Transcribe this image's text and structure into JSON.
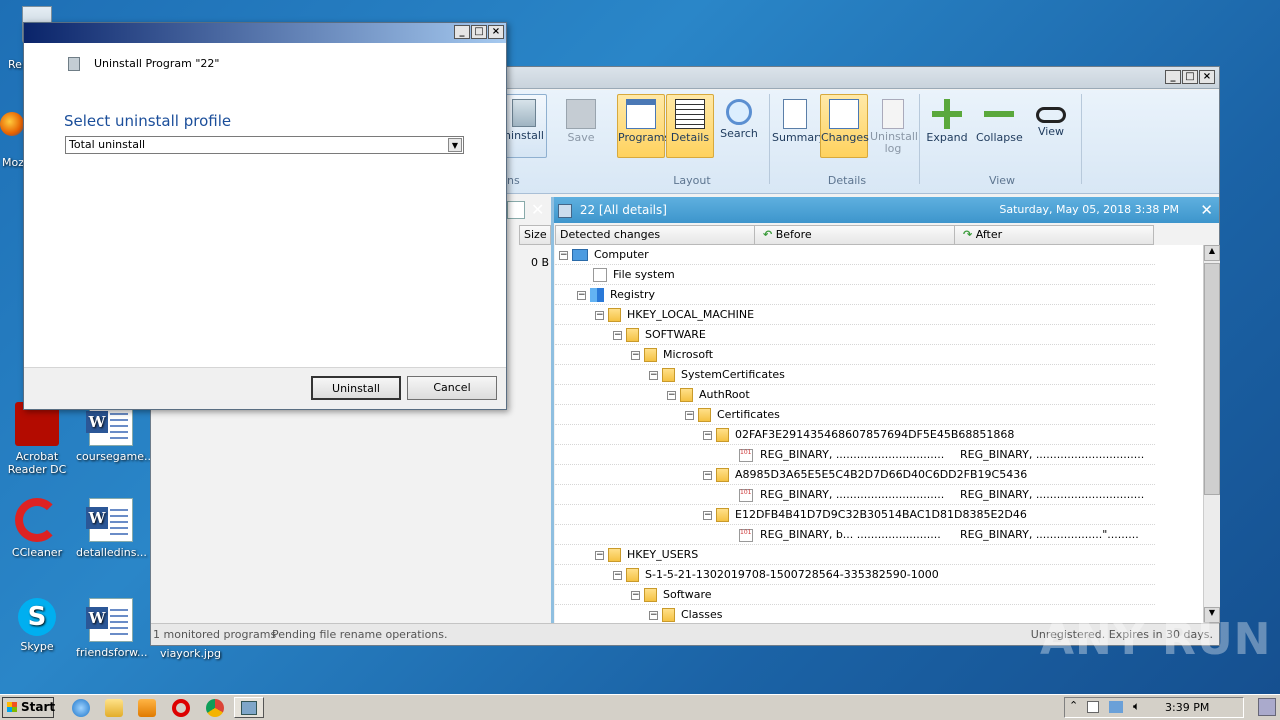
{
  "desktop": {
    "icons": [
      {
        "label": "Re",
        "kind": "recycle"
      },
      {
        "label": "Moz",
        "kind": "firefox"
      },
      {
        "label": "Acrobat Reader DC",
        "kind": "acrobat"
      },
      {
        "label": "coursegame...",
        "kind": "word"
      },
      {
        "label": "CCleaner",
        "kind": "ccleaner"
      },
      {
        "label": "detalledins...",
        "kind": "word"
      },
      {
        "label": "Skype",
        "kind": "skype"
      },
      {
        "label": "friendsforw...",
        "kind": "word"
      },
      {
        "label": "viayork.jpg",
        "kind": "image"
      }
    ],
    "watermark": "ANY RUN"
  },
  "main_window": {
    "ribbon": {
      "buttons": [
        {
          "label": "Uninstall",
          "visible_label": "ninstall",
          "state": "normal"
        },
        {
          "label": "Save",
          "state": "disabled"
        },
        {
          "label": "Programs",
          "state": "active"
        },
        {
          "label": "Details",
          "state": "active"
        },
        {
          "label": "Search",
          "state": "normal"
        },
        {
          "label": "Summary",
          "state": "normal"
        },
        {
          "label": "Changes",
          "state": "active"
        },
        {
          "label": "Uninstall log",
          "state": "disabled"
        },
        {
          "label": "Expand",
          "state": "normal"
        },
        {
          "label": "Collapse",
          "state": "normal"
        },
        {
          "label": "View",
          "state": "normal"
        }
      ],
      "groups": [
        "ns",
        "Layout",
        "Details",
        "View"
      ]
    },
    "left_panel": {
      "size_header": "Size",
      "size_value": "0 B"
    },
    "details_bar": {
      "title": "22 [All details]",
      "date": "Saturday, May 05, 2018 3:38 PM"
    },
    "columns": {
      "detected": "Detected changes",
      "before": "Before",
      "after": "After"
    },
    "tree": [
      {
        "text": "Computer",
        "before": "",
        "after": ""
      },
      {
        "text": "File system",
        "before": "",
        "after": ""
      },
      {
        "text": "Registry",
        "before": "",
        "after": ""
      },
      {
        "text": "HKEY_LOCAL_MACHINE",
        "before": "",
        "after": ""
      },
      {
        "text": "SOFTWARE",
        "before": "",
        "after": ""
      },
      {
        "text": "Microsoft",
        "before": "",
        "after": ""
      },
      {
        "text": "SystemCertificates",
        "before": "",
        "after": ""
      },
      {
        "text": "AuthRoot",
        "before": "",
        "after": ""
      },
      {
        "text": "Certificates",
        "before": "",
        "after": ""
      },
      {
        "text": "02FAF3E291435468607857694DF5E45B68851868",
        "before": "",
        "after": ""
      },
      {
        "text": "",
        "before": "REG_BINARY, ...............................",
        "after": "REG_BINARY, ..............................."
      },
      {
        "text": "A8985D3A65E5E5C4B2D7D66D40C6DD2FB19C5436",
        "before": "",
        "after": ""
      },
      {
        "text": "",
        "before": "REG_BINARY, ...............................",
        "after": "REG_BINARY, ..............................."
      },
      {
        "text": "E12DFB4B41D7D9C32B30514BAC1D81D8385E2D46",
        "before": "",
        "after": ""
      },
      {
        "text": "",
        "before": "REG_BINARY, b... ........................",
        "after": "REG_BINARY, ...................\"........."
      },
      {
        "text": "HKEY_USERS",
        "before": "",
        "after": ""
      },
      {
        "text": "S-1-5-21-1302019708-1500728564-335382590-1000",
        "before": "",
        "after": ""
      },
      {
        "text": "Software",
        "before": "",
        "after": ""
      },
      {
        "text": "Classes",
        "before": "",
        "after": ""
      }
    ],
    "status": {
      "monitored": "1 monitored programs",
      "pending": "Pending file rename operations.",
      "registration": "Unregistered. Expires in 30 days."
    }
  },
  "dialog": {
    "heading": "Uninstall Program \"22\"",
    "profile_label": "Select uninstall profile",
    "profile_value": "Total uninstall",
    "uninstall_label": "Uninstall",
    "cancel_label": "Cancel"
  },
  "taskbar": {
    "start_label": "Start",
    "clock": "3:39 PM"
  }
}
